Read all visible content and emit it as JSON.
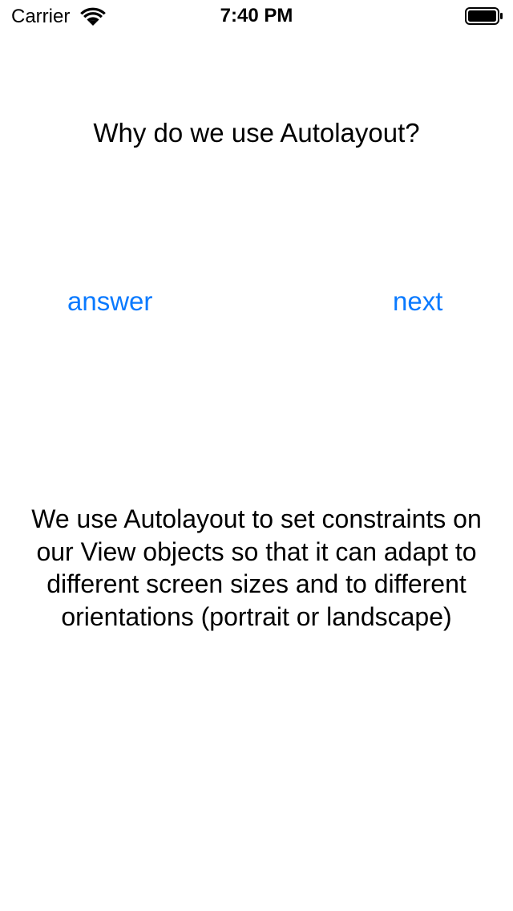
{
  "status_bar": {
    "carrier": "Carrier",
    "time": "7:40 PM",
    "wifi_icon": "wifi-icon",
    "battery_icon": "battery-icon"
  },
  "question": "Why do we use Autolayout?",
  "buttons": {
    "answer_label": "answer",
    "next_label": "next"
  },
  "answer": "We use Autolayout to set constraints on our View objects so that it can adapt to different screen sizes and to different orientations (portrait or landscape)",
  "colors": {
    "link": "#0a7aff",
    "text": "#000000",
    "background": "#ffffff"
  }
}
